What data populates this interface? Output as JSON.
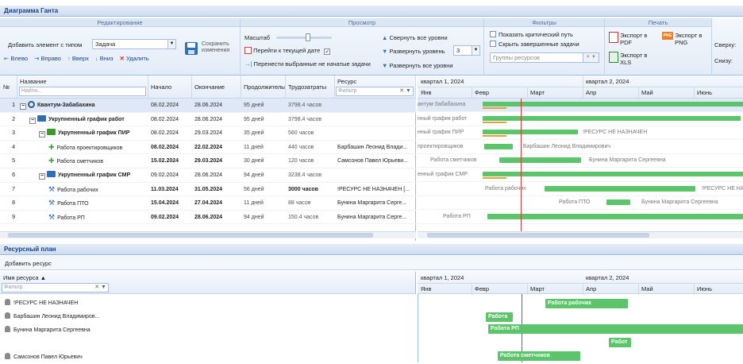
{
  "window": {
    "title": "Диаграмма Ганта"
  },
  "ribbon": {
    "edit": {
      "title": "Редактирование",
      "add_label": "Добавить элемент с типом",
      "add_type": "Задача",
      "save_label": "Сохранить изменения",
      "left": "Влево",
      "right": "Вправо",
      "up": "Вверх",
      "down": "Вниз",
      "delete": "Удалить"
    },
    "view": {
      "title": "Просмотр",
      "scale": "Масштаб",
      "goto_today": "Перейти к текущей дате",
      "move_not_started": "Перенести выбранные не начатые задачи",
      "collapse_all": "Свернуть все уровни",
      "expand_level": "Развернуть уровень",
      "expand_level_value": "3",
      "expand_all": "Развернуть все уровни"
    },
    "filters": {
      "title": "Фильтры",
      "critical": "Показать критический путь",
      "hide_done": "Скрыть завершенные задачи",
      "resource_groups": "Группы ресурсов"
    },
    "print": {
      "title": "Печать",
      "pdf": "Экспорт в PDF",
      "png": "Экспорт в PNG",
      "xls": "Экспорт в XLS",
      "png_badge": "PNG",
      "top": "Сверху:",
      "bottom": "Снизу:"
    }
  },
  "grid": {
    "headers": {
      "num": "№",
      "name": "Название",
      "start": "Начало",
      "end": "Окончание",
      "dur": "Продолжительность",
      "work": "Трудозатраты",
      "res": "Ресурс"
    },
    "name_placeholder": "Найти...",
    "res_placeholder": "Фильтр",
    "rows": [
      {
        "num": "1",
        "name": "Квантум-Забабахина",
        "start": "08.02.2024",
        "end": "28.06.2024",
        "dur": "95 дней",
        "work": "3798.4 часов",
        "res": ""
      },
      {
        "num": "2",
        "name": "Укрупненный график работ",
        "start": "08.02.2024",
        "end": "28.06.2024",
        "dur": "95 дней",
        "work": "3798.4 часов",
        "res": ""
      },
      {
        "num": "3",
        "name": "Укрупненный график ПИР",
        "start": "08.02.2024",
        "end": "29.03.2024",
        "dur": "35 дней",
        "work": "560 часов",
        "res": ""
      },
      {
        "num": "4",
        "name": "Работа проектировщиков",
        "start": "08.02.2024",
        "end": "22.02.2024",
        "dur": "11 дней",
        "work": "440 часов",
        "res": "Барбашин Леонид Влади..."
      },
      {
        "num": "5",
        "name": "Работа сметчиков",
        "start": "15.02.2024",
        "end": "29.03.2024",
        "dur": "30 дней",
        "work": "120 часов",
        "res": "Самсонов Павел Юрьеви..."
      },
      {
        "num": "6",
        "name": "Укрупненный график СМР",
        "start": "09.02.2024",
        "end": "28.06.2024",
        "dur": "94 дней",
        "work": "3238.4 часов",
        "res": ""
      },
      {
        "num": "7",
        "name": "Работа рабочих",
        "start": "11.03.2024",
        "end": "31.05.2024",
        "dur": "56 дней",
        "work": "3000 часов",
        "res": "!РЕСУРС НЕ НАЗНАЧЕН [..."
      },
      {
        "num": "8",
        "name": "Работа ПТО",
        "start": "15.04.2024",
        "end": "27.04.2024",
        "dur": "11 дней",
        "work": "88 часов",
        "res": "Бунина Маргарита Серге..."
      },
      {
        "num": "9",
        "name": "Работа РП",
        "start": "09.02.2024",
        "end": "28.06.2024",
        "dur": "94 дней",
        "work": "150.4 часов",
        "res": "Бунина Маргарита Серге..."
      }
    ]
  },
  "timeline": {
    "quarters": [
      "квартал 1, 2024",
      "квартал 2, 2024"
    ],
    "months": [
      "Янв",
      "Февр",
      "Март",
      "Апр",
      "Май",
      "Июнь"
    ],
    "bar_labels": {
      "r1": "антум-Забабахина",
      "r2": "нный график работ",
      "r3": "нный график ПИР",
      "r3b": "!РЕСУРС НЕ НАЗНАЧЕН",
      "r4": "проектировщиков",
      "r4b": "Барбашин Леонид Владимирович",
      "r5": "Работа сметчиков",
      "r5b": "Бунина Маргарита Сергеевна",
      "r6": "енный график СМР",
      "r7": "Работа рабочих",
      "r7b": "!РЕСУРС НЕ НА",
      "r8": "Работа ПТО",
      "r8b": "Бунина Маргарита Сергеевна",
      "r9": "Работа РП"
    }
  },
  "resources": {
    "title": "Ресурсный план",
    "add": "Добавить ресурс",
    "col": "Имя ресурса",
    "filter_placeholder": "Фильтр",
    "items": [
      "!РЕСУРС НЕ НАЗНАЧЕН",
      "Барбашин Леонид Владимиров...",
      "Бунина Маргарита Сергеевна",
      "Самсонов Павел Юрьевич"
    ],
    "bars": {
      "b1": "Работа рабочих",
      "b2": "Работа",
      "b3": "Работа РП",
      "b4": "Работ",
      "b5": "Работа сметчиков"
    }
  }
}
